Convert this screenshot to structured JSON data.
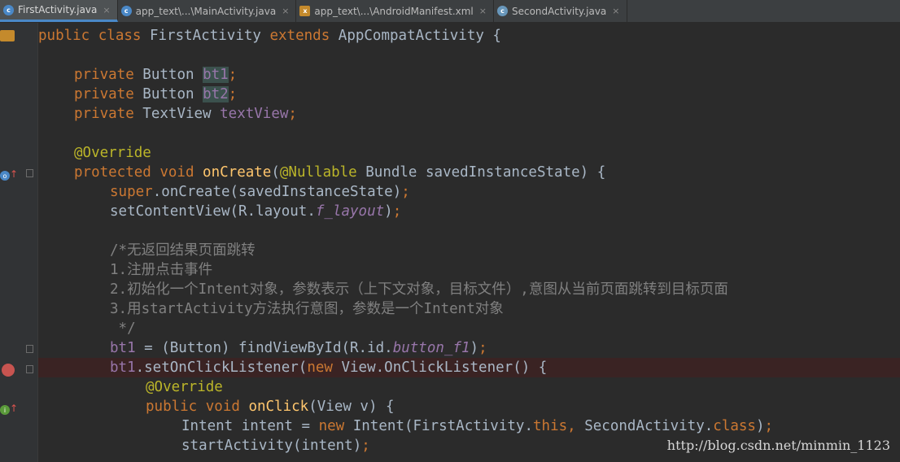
{
  "tabs": [
    {
      "label": "FirstActivity.java",
      "icon": "java-class-icon",
      "active": true
    },
    {
      "label": "app_text\\...\\MainActivity.java",
      "icon": "java-class-icon",
      "active": false
    },
    {
      "label": "app_text\\...\\AndroidManifest.xml",
      "icon": "xml-file-icon",
      "active": false
    },
    {
      "label": "SecondActivity.java",
      "icon": "java-class-icon",
      "active": false
    }
  ],
  "close_glyph": "×",
  "code": {
    "l1": {
      "a": "public class ",
      "b": "FirstActivity ",
      "c": "extends ",
      "d": "AppCompatActivity {"
    },
    "l3": {
      "a": "private ",
      "b": "Button ",
      "c": "bt1",
      ";": ";"
    },
    "l4": {
      "a": "private ",
      "b": "Button ",
      "c": "bt2",
      ";": ";"
    },
    "l5": {
      "a": "private ",
      "b": "TextView ",
      "c": "textView",
      ";": ";"
    },
    "l7": {
      "a": "@Override"
    },
    "l8": {
      "a": "protected ",
      "b": "void ",
      "c": "onCreate",
      "d": "(",
      "e": "@Nullable ",
      "f": "Bundle savedInstanceState) {"
    },
    "l9": {
      "a": "super",
      "b": ".onCreate(savedInstanceState)",
      "c": ";"
    },
    "l10": {
      "a": "setContentView(R.layout.",
      "b": "f_layout",
      "c": ")",
      ";": ";"
    },
    "l12": {
      "a": "/*无返回结果页面跳转"
    },
    "l13": {
      "a": "1.注册点击事件"
    },
    "l14": {
      "a": "2.初始化一个Intent对象，参数表示（上下文对象，目标文件）,意图从当前页面跳转到目标页面"
    },
    "l15": {
      "a": "3.用startActivity方法执行意图，参数是一个Intent对象"
    },
    "l16": {
      "a": " */"
    },
    "l17": {
      "a": "bt1 ",
      "b": "= (Button) findViewById(R.id.",
      "c": "button_f1",
      "d": ")",
      ";": ";"
    },
    "l18": {
      "a": "bt1",
      "b": ".setOnClickListener(",
      "c": "new ",
      "d": "View.OnClickListener() {"
    },
    "l19": {
      "a": "@Override"
    },
    "l20": {
      "a": "public ",
      "b": "void ",
      "c": "onClick",
      "d": "(View v) {"
    },
    "l21": {
      "a": "Intent intent = ",
      "b": "new ",
      "c": "Intent(FirstActivity.",
      "d": "this",
      ",": ", ",
      "e": "SecondActivity.",
      "f": "class",
      "g": ")",
      ";": ";"
    },
    "l22": {
      "a": "startActivity(intent)",
      ";": ";"
    }
  },
  "watermark": "http://blog.csdn.net/minmin_1123",
  "colors": {
    "keyword": "#cc7832",
    "method": "#ffc66d",
    "annotation": "#bbb529",
    "field": "#9876aa",
    "comment": "#808080",
    "text": "#a9b7c6",
    "background": "#2b2b2b",
    "breakpoint": "#c75450"
  }
}
